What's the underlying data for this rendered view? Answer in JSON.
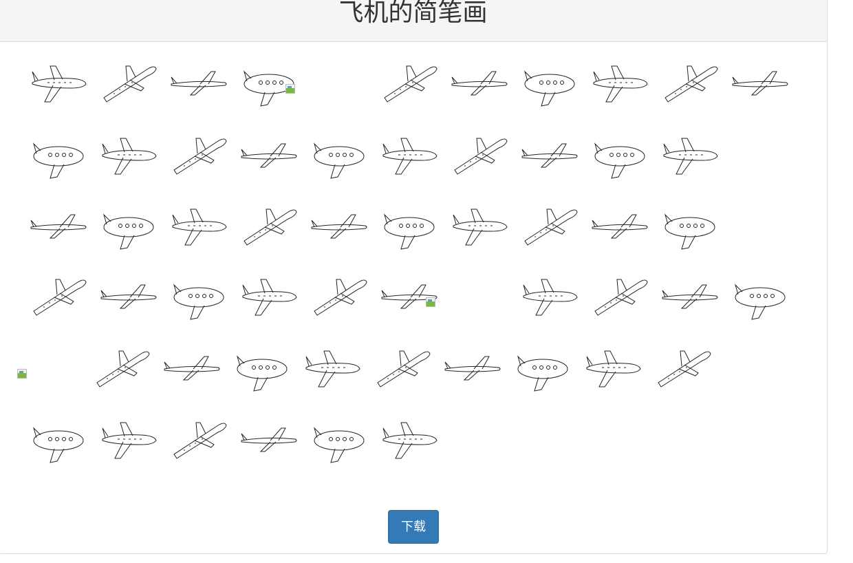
{
  "page": {
    "title": "飞机的简笔画",
    "download_label": "下载"
  },
  "gallery": {
    "rows": [
      [
        "plane",
        "plane",
        "plane",
        "plane",
        "broken-image",
        "plane",
        "plane",
        "plane",
        "plane",
        "plane",
        "plane"
      ],
      [
        "plane",
        "plane",
        "plane",
        "plane",
        "plane",
        "plane",
        "plane",
        "plane",
        "plane",
        "plane"
      ],
      [
        "plane",
        "plane",
        "plane",
        "plane",
        "plane",
        "plane",
        "plane",
        "plane",
        "plane",
        "plane"
      ],
      [
        "plane",
        "plane",
        "plane",
        "plane",
        "plane",
        "plane",
        "broken-image",
        "plane",
        "plane",
        "plane",
        "plane"
      ],
      [
        "broken-image",
        "plane",
        "plane",
        "plane",
        "plane",
        "plane",
        "plane",
        "plane",
        "plane",
        "plane"
      ],
      [
        "plane",
        "plane",
        "plane",
        "plane",
        "plane",
        "plane"
      ]
    ]
  },
  "colors": {
    "accent": "#337ab7",
    "heading_bg": "#f5f5f5",
    "border": "#dddddd",
    "stroke": "#222222"
  }
}
